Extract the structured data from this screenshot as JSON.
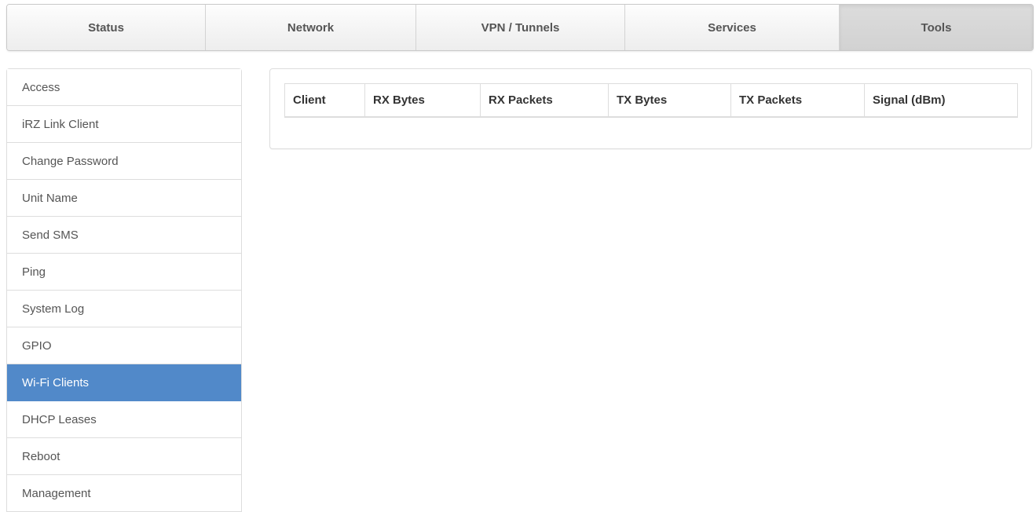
{
  "topnav": {
    "tabs": [
      {
        "label": "Status"
      },
      {
        "label": "Network"
      },
      {
        "label": "VPN / Tunnels"
      },
      {
        "label": "Services"
      },
      {
        "label": "Tools"
      }
    ],
    "active_tab": "Tools"
  },
  "sidebar": {
    "items": [
      {
        "label": "Access"
      },
      {
        "label": "iRZ Link Client"
      },
      {
        "label": "Change Password"
      },
      {
        "label": "Unit Name"
      },
      {
        "label": "Send SMS"
      },
      {
        "label": "Ping"
      },
      {
        "label": "System Log"
      },
      {
        "label": "GPIO"
      },
      {
        "label": "Wi-Fi Clients"
      },
      {
        "label": "DHCP Leases"
      },
      {
        "label": "Reboot"
      },
      {
        "label": "Management"
      }
    ],
    "active_item": "Wi-Fi Clients"
  },
  "main": {
    "table": {
      "columns": [
        "Client",
        "RX Bytes",
        "RX Packets",
        "TX Bytes",
        "TX Packets",
        "Signal (dBm)"
      ],
      "rows": []
    }
  },
  "colors": {
    "accent": "#5189c9",
    "border": "#dddddd",
    "tab_active_bg": "#d6d6d6"
  }
}
